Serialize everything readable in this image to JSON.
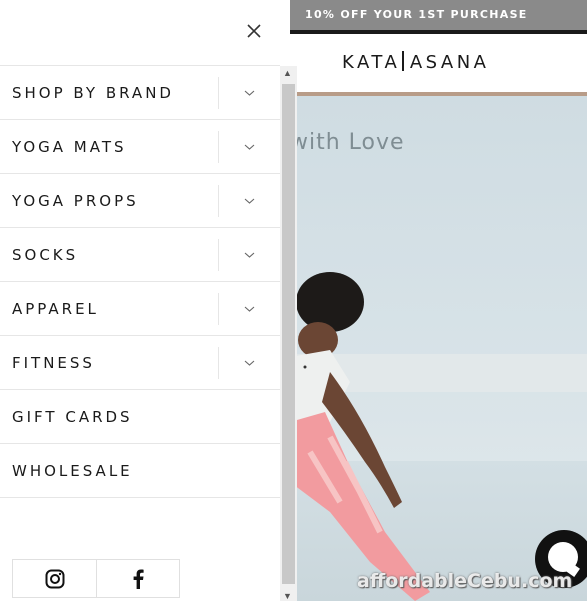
{
  "promo": {
    "text": "10% OFF YOUR 1ST PURCHASE"
  },
  "header": {
    "logo_left": "KATA",
    "logo_right": "ASANA"
  },
  "hero": {
    "tagline": "with Love"
  },
  "drawer": {
    "close_icon": "close-icon",
    "menu": [
      {
        "label": "SHOP BY BRAND",
        "expandable": true
      },
      {
        "label": "YOGA MATS",
        "expandable": true
      },
      {
        "label": "YOGA PROPS",
        "expandable": true
      },
      {
        "label": "SOCKS",
        "expandable": true
      },
      {
        "label": "APPAREL",
        "expandable": true
      },
      {
        "label": "FITNESS",
        "expandable": true
      },
      {
        "label": "GIFT CARDS",
        "expandable": false
      },
      {
        "label": "WHOLESALE",
        "expandable": false
      }
    ],
    "social": [
      {
        "icon": "instagram-icon"
      },
      {
        "icon": "facebook-icon"
      }
    ]
  },
  "chat": {
    "icon": "chat-icon"
  },
  "watermark": {
    "text": "affordableCebu.com"
  },
  "colors": {
    "text": "#1a1a1a",
    "promo_bg": "#8a8a8a",
    "divider": "#e6e6e6",
    "chat_bg": "#111111"
  }
}
